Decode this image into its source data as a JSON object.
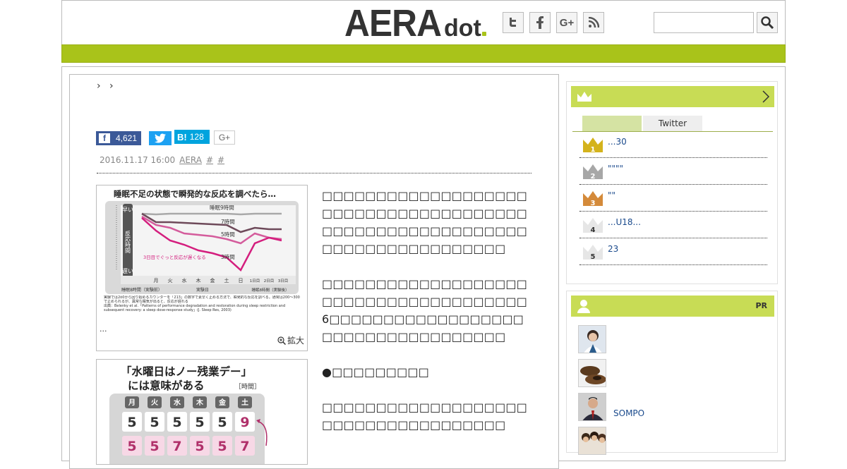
{
  "header": {
    "logo_main": "AERA",
    "logo_sub": "dot",
    "social": [
      {
        "name": "twitter-icon",
        "glyph": "t"
      },
      {
        "name": "facebook-icon",
        "glyph": "f"
      },
      {
        "name": "googleplus-icon",
        "glyph": "G+"
      },
      {
        "name": "rss-icon",
        "glyph": ")))"
      }
    ],
    "search_placeholder": ""
  },
  "article": {
    "breadcrumb": "› ›",
    "share": {
      "facebook_count": "4,621",
      "hatena_label": "B!",
      "hatena_count": "128",
      "googleplus_label": "G+"
    },
    "meta": {
      "date": "2016.11.17 16:00",
      "source": "AERA",
      "tag1": "#",
      "tag2": "#"
    },
    "figure1": {
      "title": "睡眠不足の状態で瞬発的な反応を調べたら…",
      "caption": "...",
      "zoom": "拡大",
      "series": [
        "睡眠9時間",
        "7時間",
        "5時間",
        "3時間"
      ],
      "yaxis_top": "早い",
      "yaxis_mid": "反応時間",
      "yaxis_bottom": "遅い",
      "annotation": "3日目でぐっと反応が遅くなる",
      "days": [
        "月",
        "火",
        "水",
        "木",
        "金",
        "土",
        "日",
        "1日目",
        "2日目",
        "3日目"
      ],
      "xgroup1": "睡眠8時間（実験前）",
      "xgroup2": "実験日",
      "xgroup3": "睡眠8時間（実験後）",
      "note": "実験では2ô0から回り始めるカウンターを「213」の数字で素早く止める方法で、瞬発的な反応を調べる。通常は200〜300で止められるが、異常な眠気が出ると、反応が遅れる",
      "source": "出典：Belenky et al.「Patterns of performance degradation and restoration during sleep restriction and subsequent recovery: a sleep dose-response study」(J. Sleep Res, 2003)"
    },
    "figure2": {
      "title_line1": "「水曜日はノー残業デー」",
      "title_line2": "には意味がある",
      "unit": "［時間］",
      "days": [
        "月",
        "火",
        "水",
        "木",
        "金",
        "土"
      ],
      "row1": [
        "5",
        "5",
        "5",
        "5",
        "5",
        "9"
      ],
      "row2": [
        "5",
        "5",
        "7",
        "5",
        "5",
        "7"
      ]
    },
    "paragraphs": [
      "□□□□□□□□□□□□□□□□□□□□□□□□□□□□□□□□□□□□□□□□□□□□□□□□□□□□□□□□□□□□□□□□□□□□□□□□□□",
      "□□□□□□□□□□□□□□□□□□□□□□□□□□□□□□□□□□□□□□6□□□□□□□□□□□□□□□□□□□□□□□□□□□□□□□□□□□",
      "●□□□□□□□□□",
      "□□□□□□□□□□□□□□□□□□□□□□□□□□□□□□□□□□□□"
    ]
  },
  "sidebar": {
    "ranking": {
      "tabs": [
        "",
        "Twitter"
      ],
      "items": [
        {
          "rank": "1",
          "title": "...30",
          "color": "#d4b31c"
        },
        {
          "rank": "2",
          "title": "\"\"\"\"",
          "color": "#a7a7a7"
        },
        {
          "rank": "3",
          "title": "\"\"",
          "color": "#d48a3a"
        },
        {
          "rank": "4",
          "title": "...U18...",
          "color": "#dddddd"
        },
        {
          "rank": "5",
          "title": "23",
          "color": "#dddddd"
        }
      ]
    },
    "pr": {
      "label": "PR",
      "items": [
        {
          "text": ""
        },
        {
          "text": ""
        },
        {
          "text": "SOMPO"
        },
        {
          "text": ""
        }
      ]
    }
  }
}
